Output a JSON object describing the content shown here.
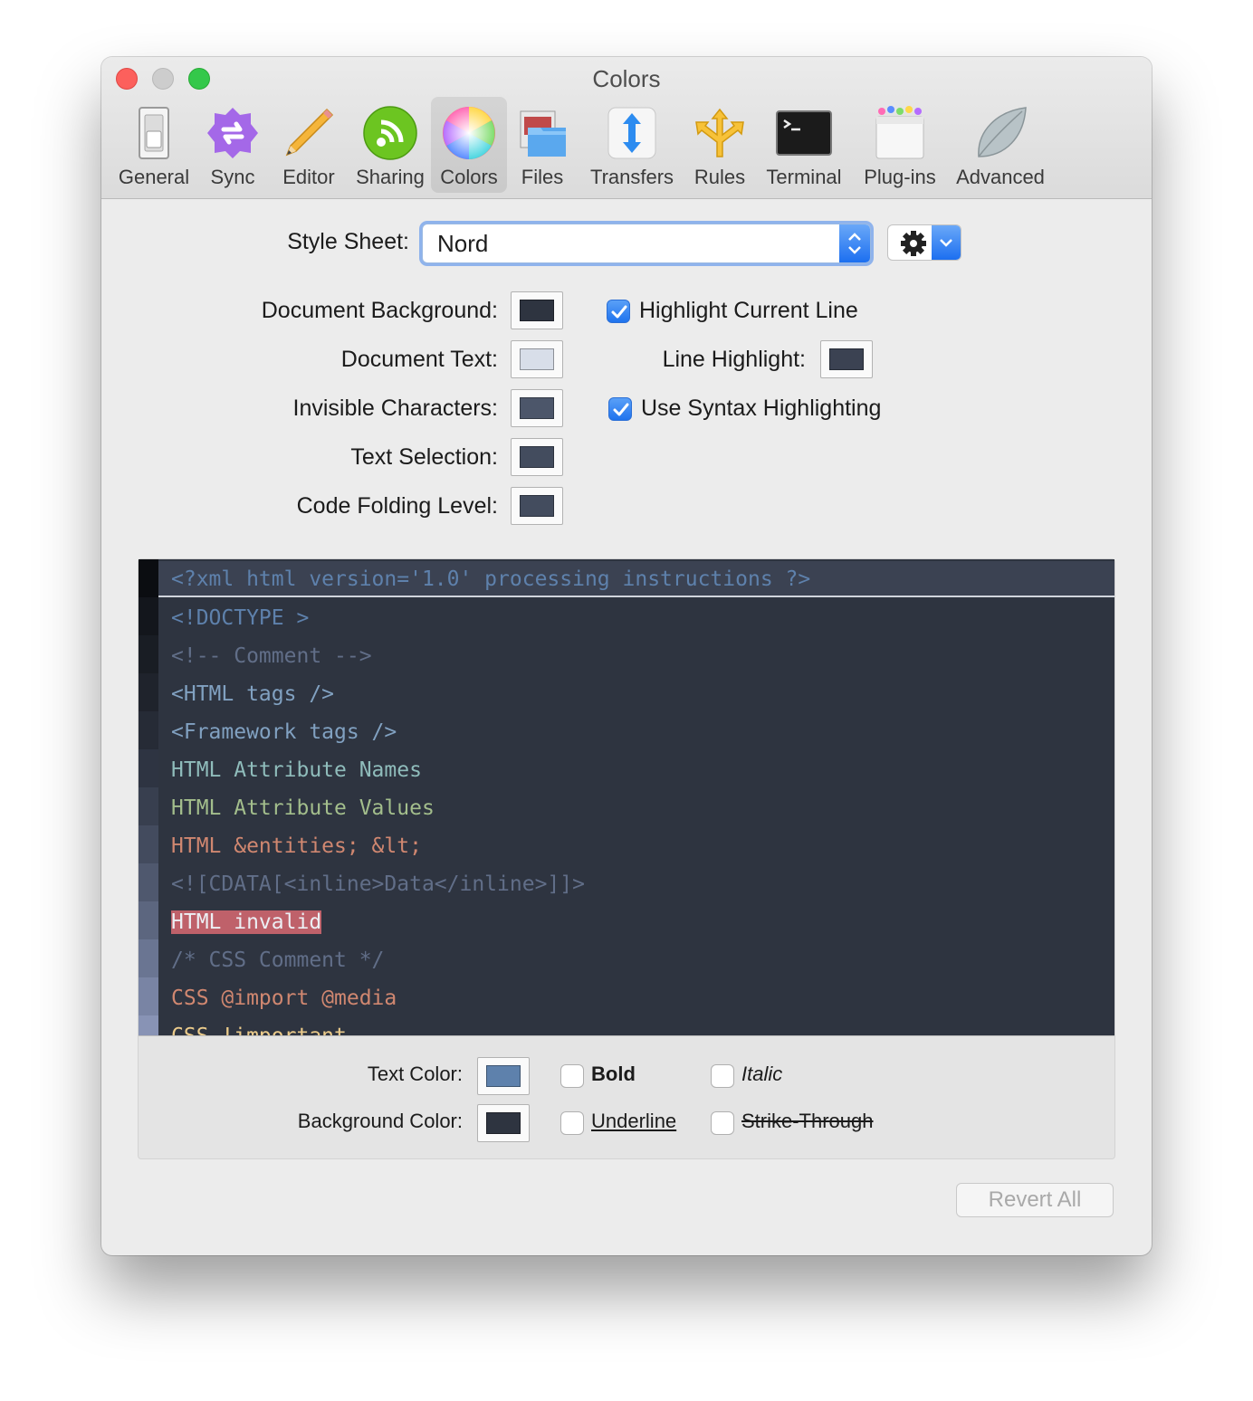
{
  "window": {
    "title": "Colors"
  },
  "toolbar": {
    "items": [
      {
        "label": "General",
        "icon": "switch-icon"
      },
      {
        "label": "Sync",
        "icon": "sync-icon"
      },
      {
        "label": "Editor",
        "icon": "pencil-icon"
      },
      {
        "label": "Sharing",
        "icon": "sharing-icon"
      },
      {
        "label": "Colors",
        "icon": "color-wheel-icon",
        "selected": true
      },
      {
        "label": "Files",
        "icon": "files-icon"
      },
      {
        "label": "Transfers",
        "icon": "transfers-icon"
      },
      {
        "label": "Rules",
        "icon": "rules-icon"
      },
      {
        "label": "Terminal",
        "icon": "terminal-icon"
      },
      {
        "label": "Plug-ins",
        "icon": "plugins-icon"
      },
      {
        "label": "Advanced",
        "icon": "leaf-icon"
      }
    ]
  },
  "stylesheet": {
    "label": "Style Sheet:",
    "value": "Nord"
  },
  "colors": {
    "document_background": {
      "label": "Document Background:",
      "color": "#2e3440"
    },
    "document_text": {
      "label": "Document Text:",
      "color": "#d8dee9"
    },
    "invisible_characters": {
      "label": "Invisible Characters:",
      "color": "#4c566a"
    },
    "text_selection": {
      "label": "Text Selection:",
      "color": "#434c5e"
    },
    "code_folding_level": {
      "label": "Code Folding Level:",
      "color": "#434c5e"
    },
    "line_highlight": {
      "label": "Line Highlight:",
      "color": "#3b4252"
    }
  },
  "options": {
    "highlight_current_line": {
      "label": "Highlight Current Line",
      "checked": true
    },
    "use_syntax_highlighting": {
      "label": "Use Syntax Highlighting",
      "checked": true
    }
  },
  "preview": {
    "lines": [
      {
        "text": "<?xml html version='1.0' processing instructions ?>",
        "color": "#5e81ac"
      },
      {
        "text": "<!DOCTYPE >",
        "color": "#5e81ac"
      },
      {
        "text": "<!-- Comment -->",
        "color": "#616e88"
      },
      {
        "text": "<HTML tags />",
        "color": "#81a1c1"
      },
      {
        "text": "<Framework tags />",
        "color": "#81a1c1"
      },
      {
        "text": "HTML Attribute Names",
        "color": "#8fbcbb"
      },
      {
        "text": "HTML Attribute Values",
        "color": "#a3be8c"
      },
      {
        "text": "HTML &entities; &lt;",
        "color": "#d08770"
      },
      {
        "text": "<![CDATA[<inline>Data</inline>]]>",
        "color": "#616e88"
      },
      {
        "text": "HTML invalid",
        "color": "#eceff4"
      },
      {
        "text": "/* CSS Comment */",
        "color": "#616e88"
      },
      {
        "text": "CSS @import @media",
        "color": "#d08770"
      },
      {
        "text": "CSS !important",
        "color": "#ebcb8b"
      }
    ],
    "gutter_colors": [
      "#0b0d11",
      "#13161c",
      "#191d24",
      "#1f232c",
      "#262b36",
      "#2e3442",
      "#383f4f",
      "#434b5e",
      "#4f586e",
      "#5c667f",
      "#6a7592",
      "#7984a4",
      "#8893b5"
    ]
  },
  "style": {
    "text_color": {
      "label": "Text Color:",
      "color": "#5e81ac"
    },
    "background_color": {
      "label": "Background Color:",
      "color": "#2e3440"
    },
    "bold": {
      "label": "Bold",
      "checked": false
    },
    "italic": {
      "label": "Italic",
      "checked": false
    },
    "underline": {
      "label": "Underline",
      "checked": false
    },
    "strikethrough": {
      "label": "Strike-Through",
      "checked": false
    }
  },
  "revert_all": "Revert All"
}
